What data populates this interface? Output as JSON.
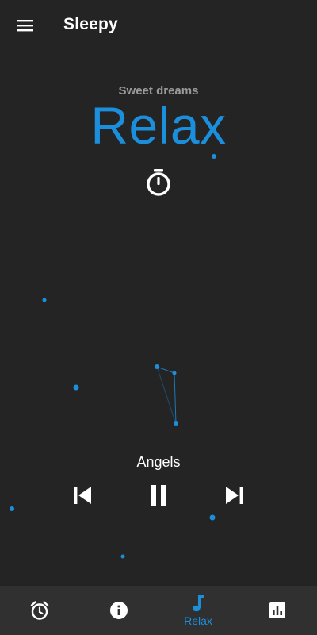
{
  "app_bar": {
    "title": "Sleepy",
    "menu_icon": "menu-icon"
  },
  "hero": {
    "subtitle": "Sweet dreams",
    "title": "Relax",
    "timer_icon": "timer-icon"
  },
  "player": {
    "track_title": "Angels",
    "state": "playing",
    "controls": [
      "skip-previous-icon",
      "pause-icon",
      "skip-next-icon"
    ]
  },
  "bottom_nav": {
    "items": [
      {
        "id": "alarm",
        "icon": "alarm-icon",
        "label": ""
      },
      {
        "id": "info",
        "icon": "info-icon",
        "label": ""
      },
      {
        "id": "relax",
        "icon": "music-note-icon",
        "label": "Relax",
        "active": true
      },
      {
        "id": "stats",
        "icon": "bar-chart-icon",
        "label": ""
      }
    ]
  },
  "colors": {
    "background": "#242424",
    "accent": "#1b8fdc",
    "subtitle": "#9a9a9a",
    "nav_background": "#303030",
    "text": "#ffffff"
  }
}
